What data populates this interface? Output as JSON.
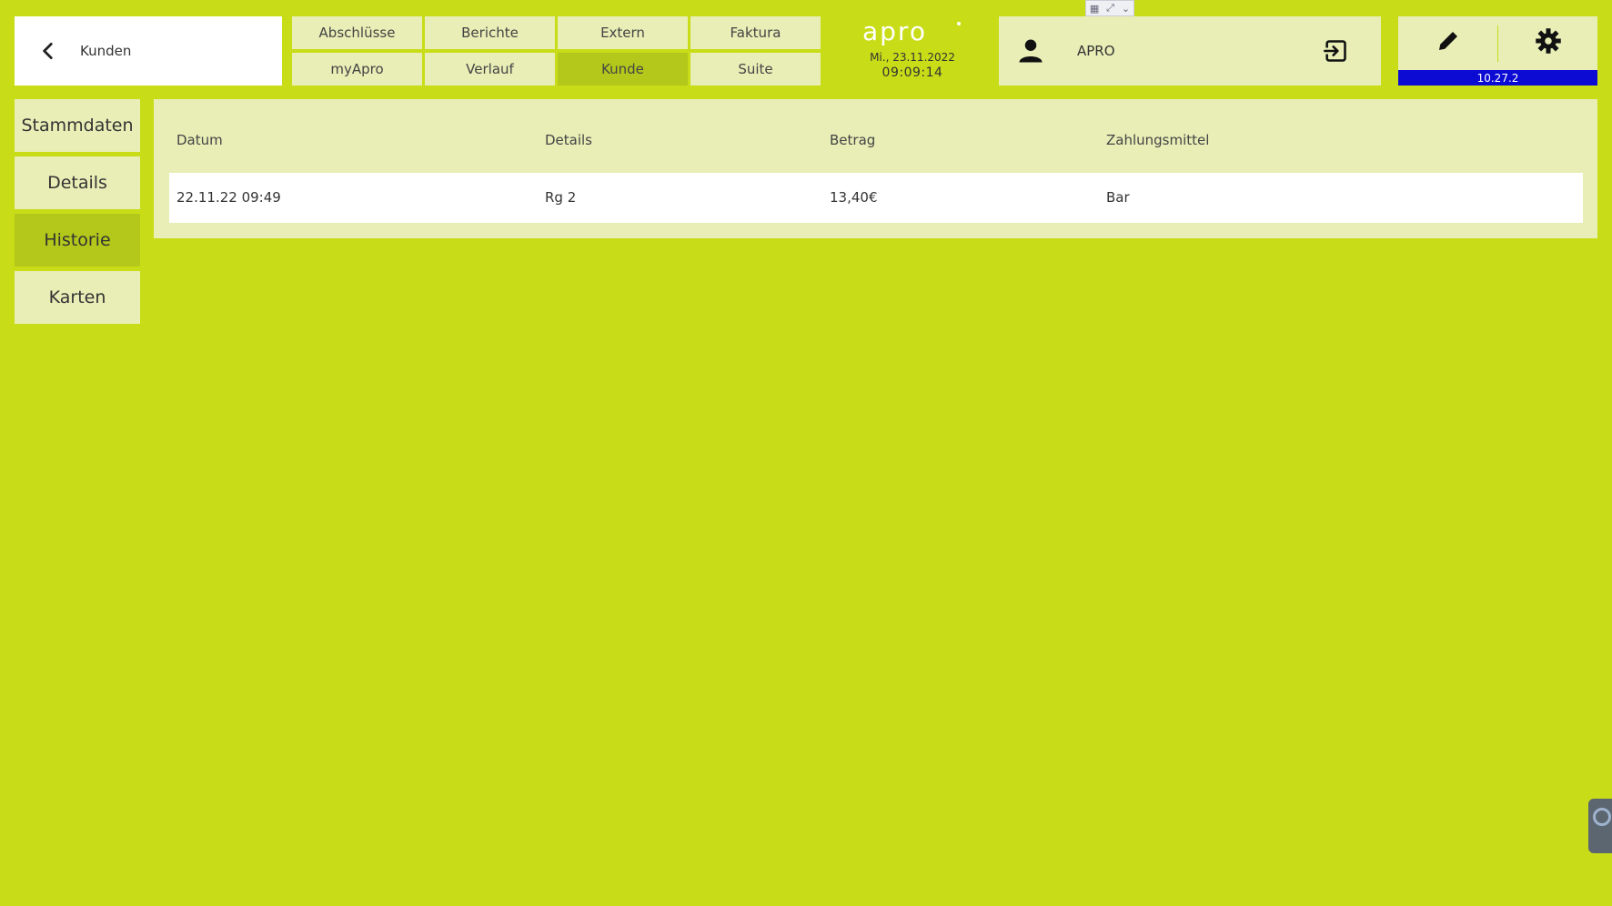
{
  "header": {
    "back_label": "Kunden",
    "tabs_row1": [
      {
        "label": "Abschlüsse"
      },
      {
        "label": "Berichte"
      },
      {
        "label": "Extern"
      },
      {
        "label": "Faktura"
      }
    ],
    "tabs_row2": [
      {
        "label": "myApro"
      },
      {
        "label": "Verlauf"
      },
      {
        "label": "Kunde"
      },
      {
        "label": "Suite"
      }
    ],
    "active_tab": "Kunde",
    "logo_text": "apro",
    "date": "Mi., 23.11.2022",
    "time": "09:09:14",
    "user_name": "APRO",
    "version": "10.27.2"
  },
  "sidebar": {
    "items": [
      {
        "label": "Stammdaten"
      },
      {
        "label": "Details"
      },
      {
        "label": "Historie"
      },
      {
        "label": "Karten"
      }
    ],
    "active": "Historie"
  },
  "history_table": {
    "columns": [
      "Datum",
      "Details",
      "Betrag",
      "Zahlungsmittel"
    ],
    "rows": [
      {
        "datum": "22.11.22 09:49",
        "details": "Rg 2",
        "betrag": "13,40€",
        "zahlungsmittel": "Bar"
      }
    ]
  },
  "colors": {
    "background": "#c8dd17",
    "tile": "#e8eeb6",
    "active": "#b3c81a",
    "version_bar": "#0b0bd4"
  },
  "icons": {
    "back": "chevron-left-icon",
    "user": "person-icon",
    "logout": "logout-icon",
    "edit": "pencil-icon",
    "settings": "gear-icon"
  }
}
